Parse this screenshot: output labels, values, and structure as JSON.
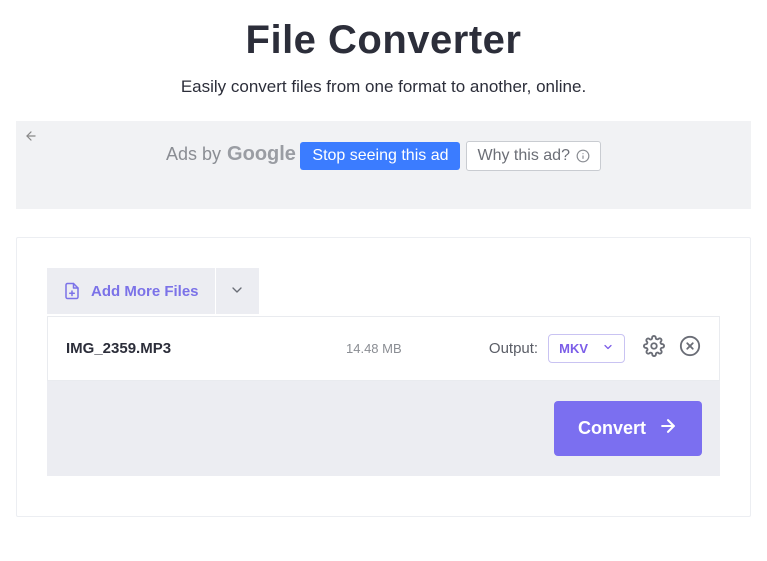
{
  "header": {
    "title": "File Converter",
    "subtitle": "Easily convert files from one format to another, online."
  },
  "ad": {
    "ads_by": "Ads by",
    "provider": "Google",
    "stop_label": "Stop seeing this ad",
    "why_label": "Why this ad?"
  },
  "toolbar": {
    "add_files_label": "Add More Files"
  },
  "file": {
    "name": "IMG_2359.MP3",
    "size": "14.48 MB",
    "output_label": "Output:",
    "format": "MKV"
  },
  "actions": {
    "convert_label": "Convert"
  }
}
